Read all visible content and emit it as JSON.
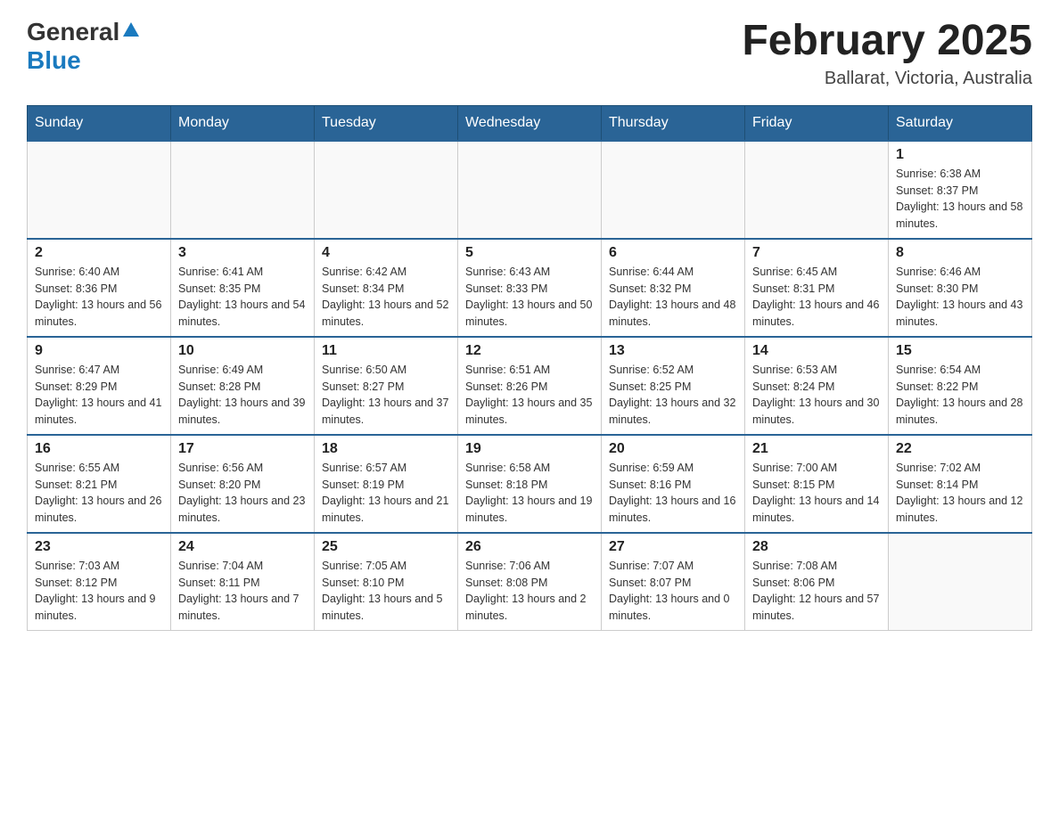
{
  "header": {
    "logo_general": "General",
    "logo_blue": "Blue",
    "title": "February 2025",
    "location": "Ballarat, Victoria, Australia"
  },
  "days_of_week": [
    "Sunday",
    "Monday",
    "Tuesday",
    "Wednesday",
    "Thursday",
    "Friday",
    "Saturday"
  ],
  "weeks": [
    [
      {
        "day": "",
        "info": ""
      },
      {
        "day": "",
        "info": ""
      },
      {
        "day": "",
        "info": ""
      },
      {
        "day": "",
        "info": ""
      },
      {
        "day": "",
        "info": ""
      },
      {
        "day": "",
        "info": ""
      },
      {
        "day": "1",
        "info": "Sunrise: 6:38 AM\nSunset: 8:37 PM\nDaylight: 13 hours and 58 minutes."
      }
    ],
    [
      {
        "day": "2",
        "info": "Sunrise: 6:40 AM\nSunset: 8:36 PM\nDaylight: 13 hours and 56 minutes."
      },
      {
        "day": "3",
        "info": "Sunrise: 6:41 AM\nSunset: 8:35 PM\nDaylight: 13 hours and 54 minutes."
      },
      {
        "day": "4",
        "info": "Sunrise: 6:42 AM\nSunset: 8:34 PM\nDaylight: 13 hours and 52 minutes."
      },
      {
        "day": "5",
        "info": "Sunrise: 6:43 AM\nSunset: 8:33 PM\nDaylight: 13 hours and 50 minutes."
      },
      {
        "day": "6",
        "info": "Sunrise: 6:44 AM\nSunset: 8:32 PM\nDaylight: 13 hours and 48 minutes."
      },
      {
        "day": "7",
        "info": "Sunrise: 6:45 AM\nSunset: 8:31 PM\nDaylight: 13 hours and 46 minutes."
      },
      {
        "day": "8",
        "info": "Sunrise: 6:46 AM\nSunset: 8:30 PM\nDaylight: 13 hours and 43 minutes."
      }
    ],
    [
      {
        "day": "9",
        "info": "Sunrise: 6:47 AM\nSunset: 8:29 PM\nDaylight: 13 hours and 41 minutes."
      },
      {
        "day": "10",
        "info": "Sunrise: 6:49 AM\nSunset: 8:28 PM\nDaylight: 13 hours and 39 minutes."
      },
      {
        "day": "11",
        "info": "Sunrise: 6:50 AM\nSunset: 8:27 PM\nDaylight: 13 hours and 37 minutes."
      },
      {
        "day": "12",
        "info": "Sunrise: 6:51 AM\nSunset: 8:26 PM\nDaylight: 13 hours and 35 minutes."
      },
      {
        "day": "13",
        "info": "Sunrise: 6:52 AM\nSunset: 8:25 PM\nDaylight: 13 hours and 32 minutes."
      },
      {
        "day": "14",
        "info": "Sunrise: 6:53 AM\nSunset: 8:24 PM\nDaylight: 13 hours and 30 minutes."
      },
      {
        "day": "15",
        "info": "Sunrise: 6:54 AM\nSunset: 8:22 PM\nDaylight: 13 hours and 28 minutes."
      }
    ],
    [
      {
        "day": "16",
        "info": "Sunrise: 6:55 AM\nSunset: 8:21 PM\nDaylight: 13 hours and 26 minutes."
      },
      {
        "day": "17",
        "info": "Sunrise: 6:56 AM\nSunset: 8:20 PM\nDaylight: 13 hours and 23 minutes."
      },
      {
        "day": "18",
        "info": "Sunrise: 6:57 AM\nSunset: 8:19 PM\nDaylight: 13 hours and 21 minutes."
      },
      {
        "day": "19",
        "info": "Sunrise: 6:58 AM\nSunset: 8:18 PM\nDaylight: 13 hours and 19 minutes."
      },
      {
        "day": "20",
        "info": "Sunrise: 6:59 AM\nSunset: 8:16 PM\nDaylight: 13 hours and 16 minutes."
      },
      {
        "day": "21",
        "info": "Sunrise: 7:00 AM\nSunset: 8:15 PM\nDaylight: 13 hours and 14 minutes."
      },
      {
        "day": "22",
        "info": "Sunrise: 7:02 AM\nSunset: 8:14 PM\nDaylight: 13 hours and 12 minutes."
      }
    ],
    [
      {
        "day": "23",
        "info": "Sunrise: 7:03 AM\nSunset: 8:12 PM\nDaylight: 13 hours and 9 minutes."
      },
      {
        "day": "24",
        "info": "Sunrise: 7:04 AM\nSunset: 8:11 PM\nDaylight: 13 hours and 7 minutes."
      },
      {
        "day": "25",
        "info": "Sunrise: 7:05 AM\nSunset: 8:10 PM\nDaylight: 13 hours and 5 minutes."
      },
      {
        "day": "26",
        "info": "Sunrise: 7:06 AM\nSunset: 8:08 PM\nDaylight: 13 hours and 2 minutes."
      },
      {
        "day": "27",
        "info": "Sunrise: 7:07 AM\nSunset: 8:07 PM\nDaylight: 13 hours and 0 minutes."
      },
      {
        "day": "28",
        "info": "Sunrise: 7:08 AM\nSunset: 8:06 PM\nDaylight: 12 hours and 57 minutes."
      },
      {
        "day": "",
        "info": ""
      }
    ]
  ]
}
